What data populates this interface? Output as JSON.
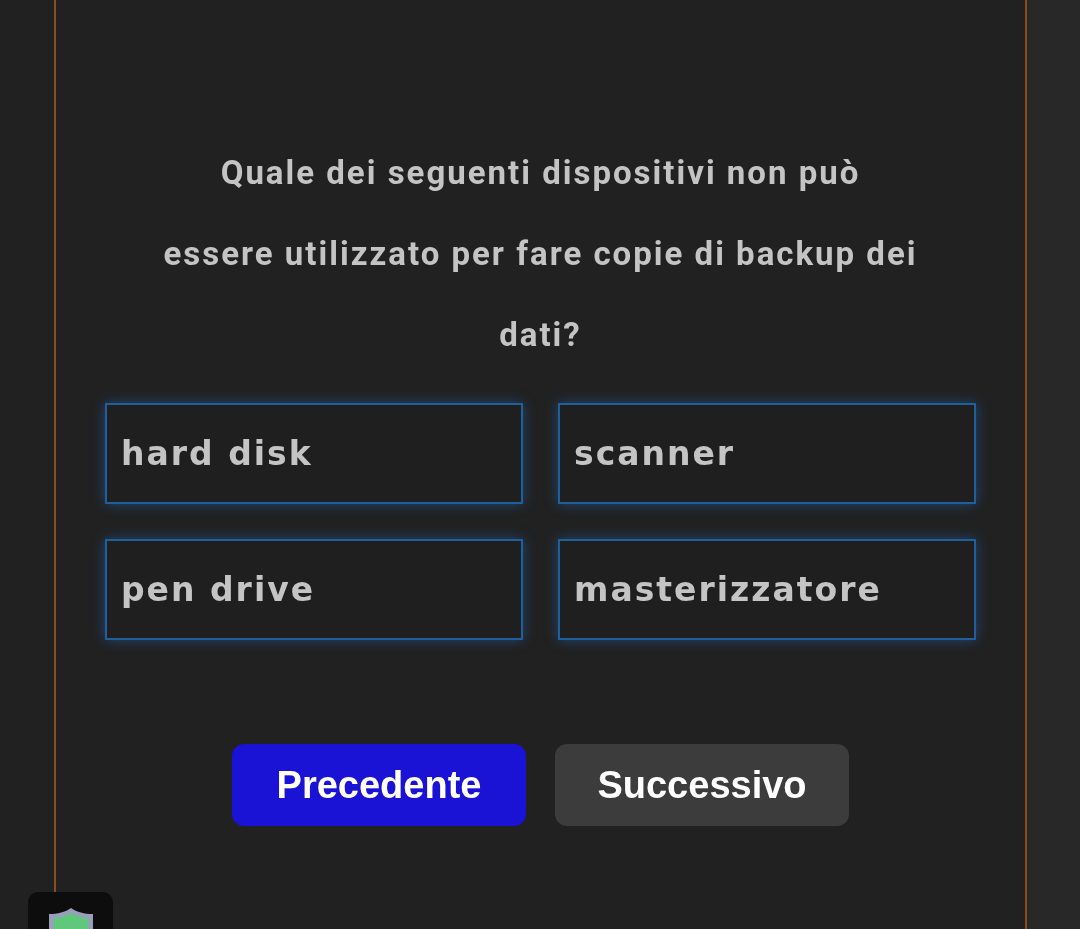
{
  "question": "Quale dei seguenti dispositivi non può essere utilizzato per fare copie di backup dei dati?",
  "options": [
    "hard disk",
    "scanner",
    "pen drive",
    "masterizzatore"
  ],
  "buttons": [
    {
      "label": "Precedente",
      "kind": "primary"
    },
    {
      "label": "Successivo",
      "kind": "secondary"
    }
  ]
}
